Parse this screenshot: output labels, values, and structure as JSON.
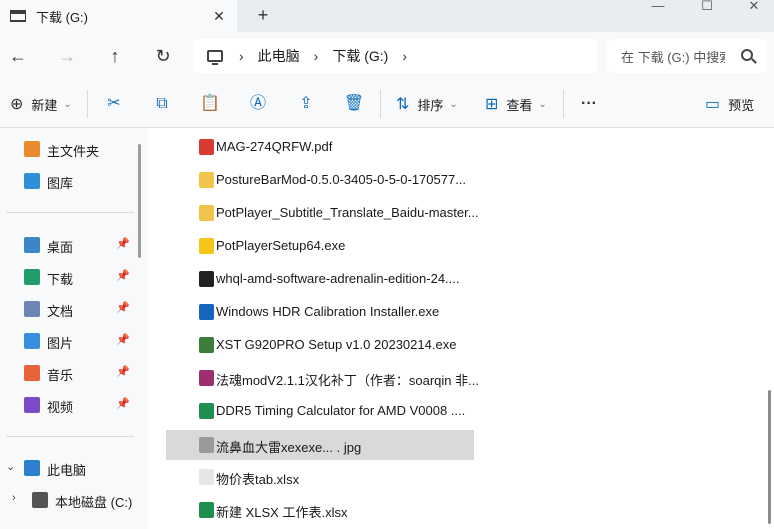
{
  "tab": {
    "title": "下载 (G:)",
    "close_glyph": "✕",
    "new_tab_glyph": "+"
  },
  "window_controls": {
    "minimize": "—",
    "maximize": "☐",
    "close": "✕"
  },
  "nav_buttons": {
    "back": "←",
    "forward": "→",
    "up": "↑",
    "refresh": "↻"
  },
  "address": {
    "separator": "›",
    "crumbs": [
      "此电脑",
      "下载 (G:)"
    ]
  },
  "search": {
    "placeholder": "在 下载 (G:) 中搜索"
  },
  "commands": {
    "new_label": "新建",
    "sort_label": "排序",
    "view_label": "查看",
    "more": "···",
    "preview_label": "预览",
    "chevron": "⌄"
  },
  "nav": {
    "items": [
      {
        "label": "主文件夹",
        "color": "#e98a2e",
        "pinned": false
      },
      {
        "label": "图库",
        "color": "#2f8fd8",
        "pinned": false
      },
      {
        "label": "桌面",
        "color": "#3a86c8",
        "pinned": true
      },
      {
        "label": "下载",
        "color": "#1f9e6b",
        "pinned": true
      },
      {
        "label": "文档",
        "color": "#6b86b5",
        "pinned": true
      },
      {
        "label": "图片",
        "color": "#3a8ee0",
        "pinned": true
      },
      {
        "label": "音乐",
        "color": "#e8623a",
        "pinned": true
      },
      {
        "label": "视频",
        "color": "#7a4cc7",
        "pinned": true
      },
      {
        "label": "此电脑",
        "color": "#2f7fd2",
        "pinned": false
      },
      {
        "label": "本地磁盘 (C:)",
        "color": "#555555",
        "pinned": false
      }
    ],
    "pin_glyph": "📌",
    "expand_down": "⌄",
    "expand_right": "›"
  },
  "files": [
    {
      "name": "MAG-274QRFW.pdf",
      "color": "#d83b32",
      "selected": false
    },
    {
      "name": "PostureBarMod-0.5.0-3405-0-5-0-170577...",
      "color": "#f2c34a",
      "selected": false
    },
    {
      "name": "PotPlayer_Subtitle_Translate_Baidu-master...",
      "color": "#f2c34a",
      "selected": false
    },
    {
      "name": "PotPlayerSetup64.exe",
      "color": "#f5c518",
      "selected": false
    },
    {
      "name": "whql-amd-software-adrenalin-edition-24....",
      "color": "#222222",
      "selected": false
    },
    {
      "name": "Windows HDR Calibration Installer.exe",
      "color": "#1565c0",
      "selected": false
    },
    {
      "name": "XST G920PRO Setup v1.0 20230214.exe",
      "color": "#3c7d3a",
      "selected": false
    },
    {
      "name": "法魂modV2.1.1汉化补丁（作者：soarqin 非...",
      "color": "#9c2f6e",
      "selected": false
    },
    {
      "name": "DDR5 Timing Calculator for AMD V0008 ....",
      "color": "#1e8f4e",
      "selected": false
    },
    {
      "name": "流鼻血大雷xexexe... . jpg",
      "color": "#9a9a9a",
      "selected": true
    },
    {
      "name": "物价表tab.xlsx",
      "color": "#e6e6e6",
      "selected": false
    },
    {
      "name": "新建 XLSX 工作表.xlsx",
      "color": "#1e8f4e",
      "selected": false
    }
  ]
}
